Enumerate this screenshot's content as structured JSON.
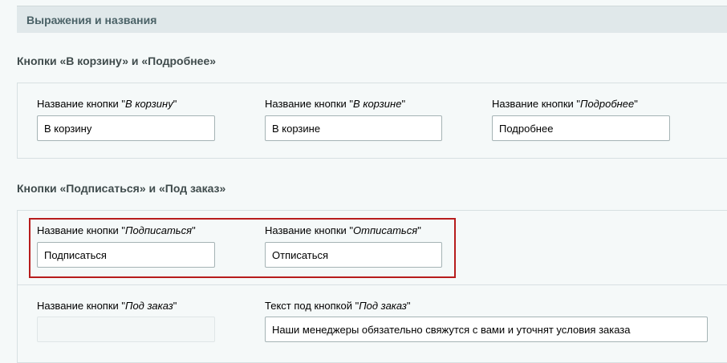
{
  "header": {
    "title": "Выражения и названия"
  },
  "section_cart": {
    "title": "Кнопки «В корзину» и «Подробнее»",
    "fields": [
      {
        "label_prefix": "Название кнопки \"",
        "label_quoted": "В корзину",
        "label_suffix": "\"",
        "value": "В корзину"
      },
      {
        "label_prefix": "Название кнопки \"",
        "label_quoted": "В корзине",
        "label_suffix": "\"",
        "value": "В корзине"
      },
      {
        "label_prefix": "Название кнопки \"",
        "label_quoted": "Подробнее",
        "label_suffix": "\"",
        "value": "Подробнее"
      }
    ]
  },
  "section_subscribe": {
    "title": "Кнопки «Подписаться» и «Под заказ»",
    "fields": [
      {
        "label_prefix": "Название кнопки \"",
        "label_quoted": "Подписаться",
        "label_suffix": "\"",
        "value": "Подписаться"
      },
      {
        "label_prefix": "Название кнопки \"",
        "label_quoted": "Отписаться",
        "label_suffix": "\"",
        "value": "Отписаться"
      },
      {
        "label_prefix": "Название кнопки \"",
        "label_quoted": "Под заказ",
        "label_suffix": "\"",
        "value": ""
      },
      {
        "label_prefix": "Текст под кнопкой \"",
        "label_quoted": "Под заказ",
        "label_suffix": "\"",
        "value": "Наши менеджеры обязательно свяжутся с вами и уточнят условия заказа"
      }
    ]
  },
  "colors": {
    "highlight": "#b71c1c",
    "header_bg": "#e0e8ea",
    "page_bg": "#f5f9f9"
  }
}
